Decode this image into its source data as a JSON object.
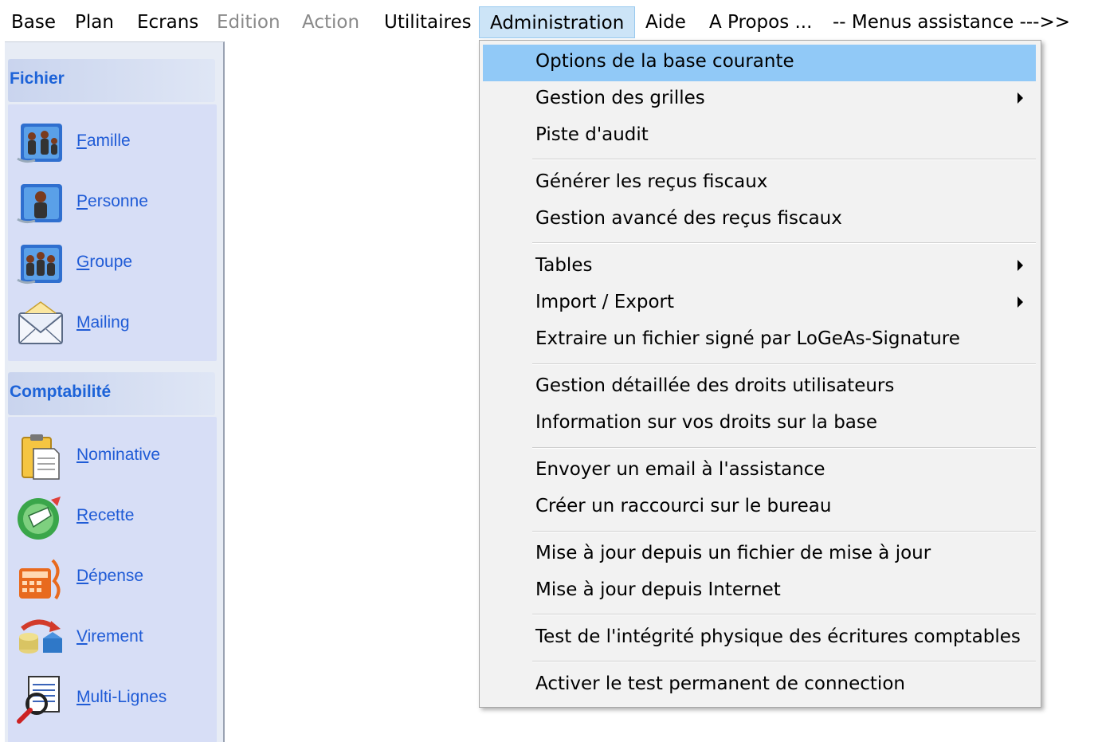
{
  "menubar": {
    "items": [
      {
        "label": "Base",
        "state": "enabled"
      },
      {
        "label": "Plan",
        "state": "enabled"
      },
      {
        "label": "Ecrans",
        "state": "enabled"
      },
      {
        "label": "Edition",
        "state": "disabled"
      },
      {
        "label": "Action",
        "state": "disabled"
      },
      {
        "label": "Utilitaires",
        "state": "enabled"
      },
      {
        "label": "Administration",
        "state": "open"
      },
      {
        "label": "Aide",
        "state": "enabled"
      },
      {
        "label": "A Propos ...",
        "state": "enabled"
      },
      {
        "label": "-- Menus assistance --->>",
        "state": "enabled"
      }
    ]
  },
  "sidebar": {
    "groups": [
      {
        "title": "Fichier",
        "items": [
          {
            "label": "Famille",
            "icon": "family-icon"
          },
          {
            "label": "Personne",
            "icon": "person-icon"
          },
          {
            "label": "Groupe",
            "icon": "group-icon"
          },
          {
            "label": "Mailing",
            "icon": "envelope-icon"
          }
        ]
      },
      {
        "title": "Comptabilité",
        "items": [
          {
            "label": "Nominative",
            "icon": "clipboard-icon"
          },
          {
            "label": "Recette",
            "icon": "receipt-icon"
          },
          {
            "label": "Dépense",
            "icon": "calculator-icon"
          },
          {
            "label": "Virement",
            "icon": "transfer-icon"
          },
          {
            "label": "Multi-Lignes",
            "icon": "multi-lines-icon"
          }
        ]
      }
    ]
  },
  "dropdown": {
    "items": [
      {
        "label": "Options de la base courante",
        "submenu": false,
        "highlight": true
      },
      {
        "label": "Gestion des grilles",
        "submenu": true
      },
      {
        "label": "Piste d'audit",
        "submenu": false
      },
      {
        "label": "Générer les reçus fiscaux",
        "submenu": false
      },
      {
        "label": "Gestion avancé des reçus fiscaux",
        "submenu": false
      },
      {
        "label": "Tables",
        "submenu": true
      },
      {
        "label": "Import / Export",
        "submenu": true
      },
      {
        "label": "Extraire un fichier signé par LoGeAs-Signature",
        "submenu": false
      },
      {
        "label": "Gestion détaillée des droits utilisateurs",
        "submenu": false
      },
      {
        "label": "Information sur vos droits sur la base",
        "submenu": false
      },
      {
        "label": "Envoyer un email à l'assistance",
        "submenu": false
      },
      {
        "label": "Créer un raccourci sur le bureau",
        "submenu": false
      },
      {
        "label": "Mise à jour depuis un fichier de mise à jour",
        "submenu": false
      },
      {
        "label": "Mise à jour depuis Internet",
        "submenu": false
      },
      {
        "label": "Test de l'intégrité physique des écritures comptables",
        "submenu": false
      },
      {
        "label": "Activer le test permanent de connection",
        "submenu": false
      }
    ]
  },
  "colors": {
    "highlight": "#91c9f7",
    "link": "#1f5bd6",
    "header_text": "#1d63d8",
    "panel": "#d7def6"
  }
}
